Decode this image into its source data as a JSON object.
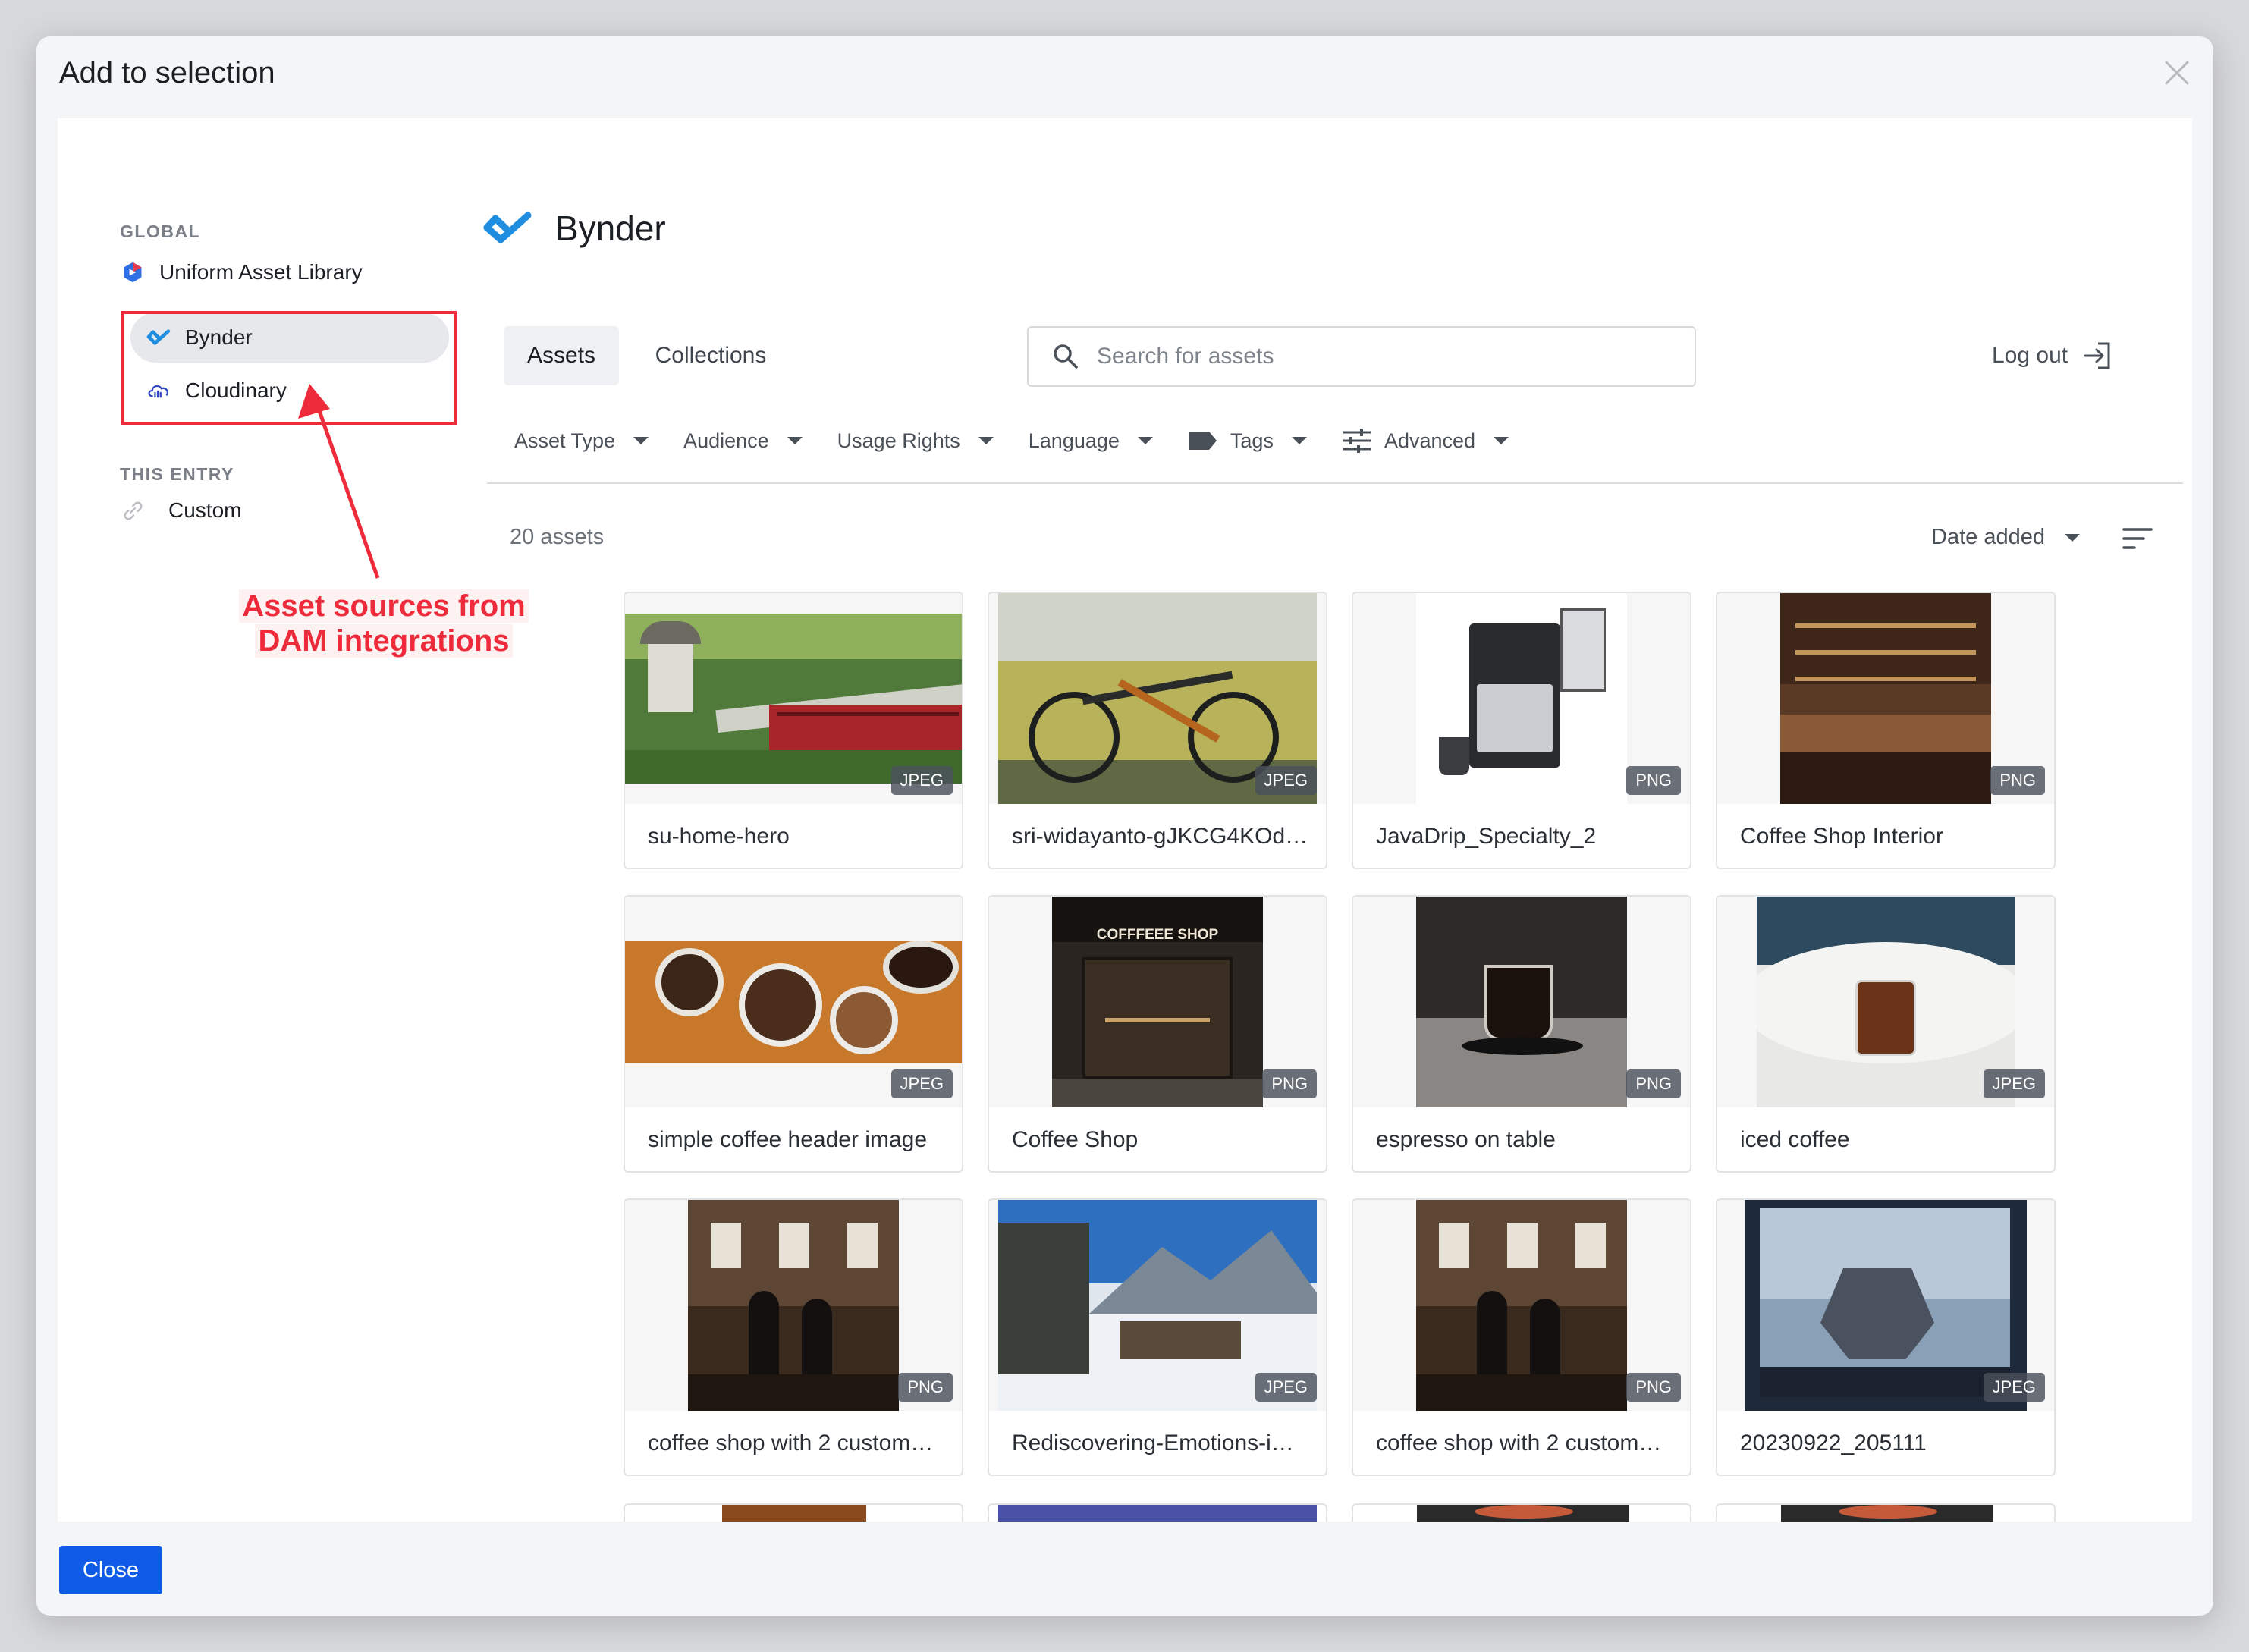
{
  "modal": {
    "title": "Add to selection"
  },
  "sidebar": {
    "global_heading": "GLOBAL",
    "entry_heading": "THIS ENTRY",
    "global_items": [
      {
        "label": "Uniform Asset Library",
        "icon": "uniform-logo-icon"
      },
      {
        "label": "Bynder",
        "icon": "bynder-logo-icon",
        "active": true
      },
      {
        "label": "Cloudinary",
        "icon": "cloudinary-logo-icon"
      }
    ],
    "entry_items": [
      {
        "label": "Custom",
        "icon": "link-icon"
      }
    ]
  },
  "annotation": {
    "line1": "Asset sources from",
    "line2": "DAM integrations",
    "color": "#ee2b3b"
  },
  "brand": {
    "name": "Bynder",
    "color": "#1f8ee0"
  },
  "tabs": [
    {
      "label": "Assets",
      "active": true
    },
    {
      "label": "Collections"
    }
  ],
  "search": {
    "placeholder": "Search for assets",
    "value": ""
  },
  "logout": {
    "label": "Log out"
  },
  "filters": [
    {
      "label": "Asset Type"
    },
    {
      "label": "Audience"
    },
    {
      "label": "Usage Rights"
    },
    {
      "label": "Language"
    },
    {
      "label": "Tags",
      "icon": "tag-icon"
    },
    {
      "label": "Advanced",
      "icon": "sliders-icon"
    }
  ],
  "results": {
    "count": "20 assets",
    "sort": "Date added"
  },
  "assets": [
    {
      "title": "su-home-hero",
      "type": "JPEG"
    },
    {
      "title": "sri-widayanto-gJKCG4KOd…",
      "type": "JPEG"
    },
    {
      "title": "JavaDrip_Specialty_2",
      "type": "PNG"
    },
    {
      "title": "Coffee Shop Interior",
      "type": "PNG"
    },
    {
      "title": "simple coffee header image",
      "type": "JPEG"
    },
    {
      "title": "Coffee Shop",
      "type": "PNG",
      "sign": "COFFFEEE SHOP"
    },
    {
      "title": "espresso on table",
      "type": "PNG"
    },
    {
      "title": "iced coffee",
      "type": "JPEG"
    },
    {
      "title": "coffee shop with 2 custom…",
      "type": "PNG"
    },
    {
      "title": "Rediscovering-Emotions-i…",
      "type": "JPEG"
    },
    {
      "title": "coffee shop with 2 custom…",
      "type": "PNG"
    },
    {
      "title": "20230922_205111",
      "type": "JPEG"
    }
  ],
  "footer": {
    "close_label": "Close",
    "accent": "#0f5ae6"
  }
}
